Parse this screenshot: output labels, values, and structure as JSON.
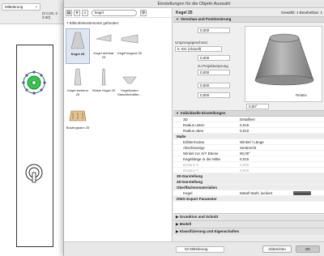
{
  "background_app": {
    "layer_select": "Mittelerung",
    "coords": "(0 0.00, 0 0.00)"
  },
  "dialog": {
    "title": "Einstellungen für die Objekt-Auswahl",
    "search_value": "kegel",
    "found_text": "7 Bibliothekselemente gefunden:",
    "items": [
      {
        "label": "Kegel 25",
        "selected": true
      },
      {
        "label": "Kegel drehbar 25"
      },
      {
        "label": "Kegel liegend 25"
      },
      {
        "label": "Kegel stehend 25"
      },
      {
        "label": "Stütze Kegel 25"
      },
      {
        "label": "Kegelboden Maschbehälter..."
      },
      {
        "label": "Bowlingbahn 25"
      }
    ],
    "element_name": "Kegel 25",
    "selection_info": "Gewählt: 1 Bearbeitbar: 1",
    "preview_section": "Vorschau und Positionierung",
    "height_value": "0,000",
    "origin_label": "Ursprungsgeschoss:",
    "origin_value": "0. EG (Aktuell)",
    "origin_offset": "0,000",
    "projection_label": "zu Projektursprung",
    "projection_value": "0,000",
    "width_value": "0,500",
    "depth_value": "0,500",
    "relative_label": "Relativ",
    "angle_value": "0,00°",
    "settings_section": "Individuelle Einstellungen",
    "props": [
      {
        "k": "3D",
        "v": "Detailliert"
      },
      {
        "k": "Radius unten",
        "v": "0,015"
      },
      {
        "k": "Radius oben",
        "v": "0,010"
      }
    ],
    "group_masse": "Maße",
    "masse": [
      {
        "k": "Editiermodus",
        "v": "Winkel / Länge"
      },
      {
        "k": "Abschlusstyp",
        "v": "Senkrecht"
      },
      {
        "k": "Winkel zur X/Y Ebene",
        "v": "90,00°"
      },
      {
        "k": "Kegellänge in der Mitte",
        "v": "0,015"
      },
      {
        "k": "Distanz X",
        "v": "0,000"
      },
      {
        "k": "Distanz Y",
        "v": "0,000"
      }
    ],
    "groups": [
      "3D-Darstellung",
      "2D-Darstellung",
      "Oberflächenmaterialien"
    ],
    "material_key": "Kegel",
    "material_value": "Metall Stahl, lackiert",
    "dwg_group": "DWG Export Parameter",
    "collapsed_sections": [
      "Grundriss und Schnitt",
      "Modell",
      "Klassifizierung und Eigenschaften"
    ],
    "footer_layer": "02 Mittelerung",
    "cancel_label": "Abbrechen",
    "ok_label": "OK"
  }
}
